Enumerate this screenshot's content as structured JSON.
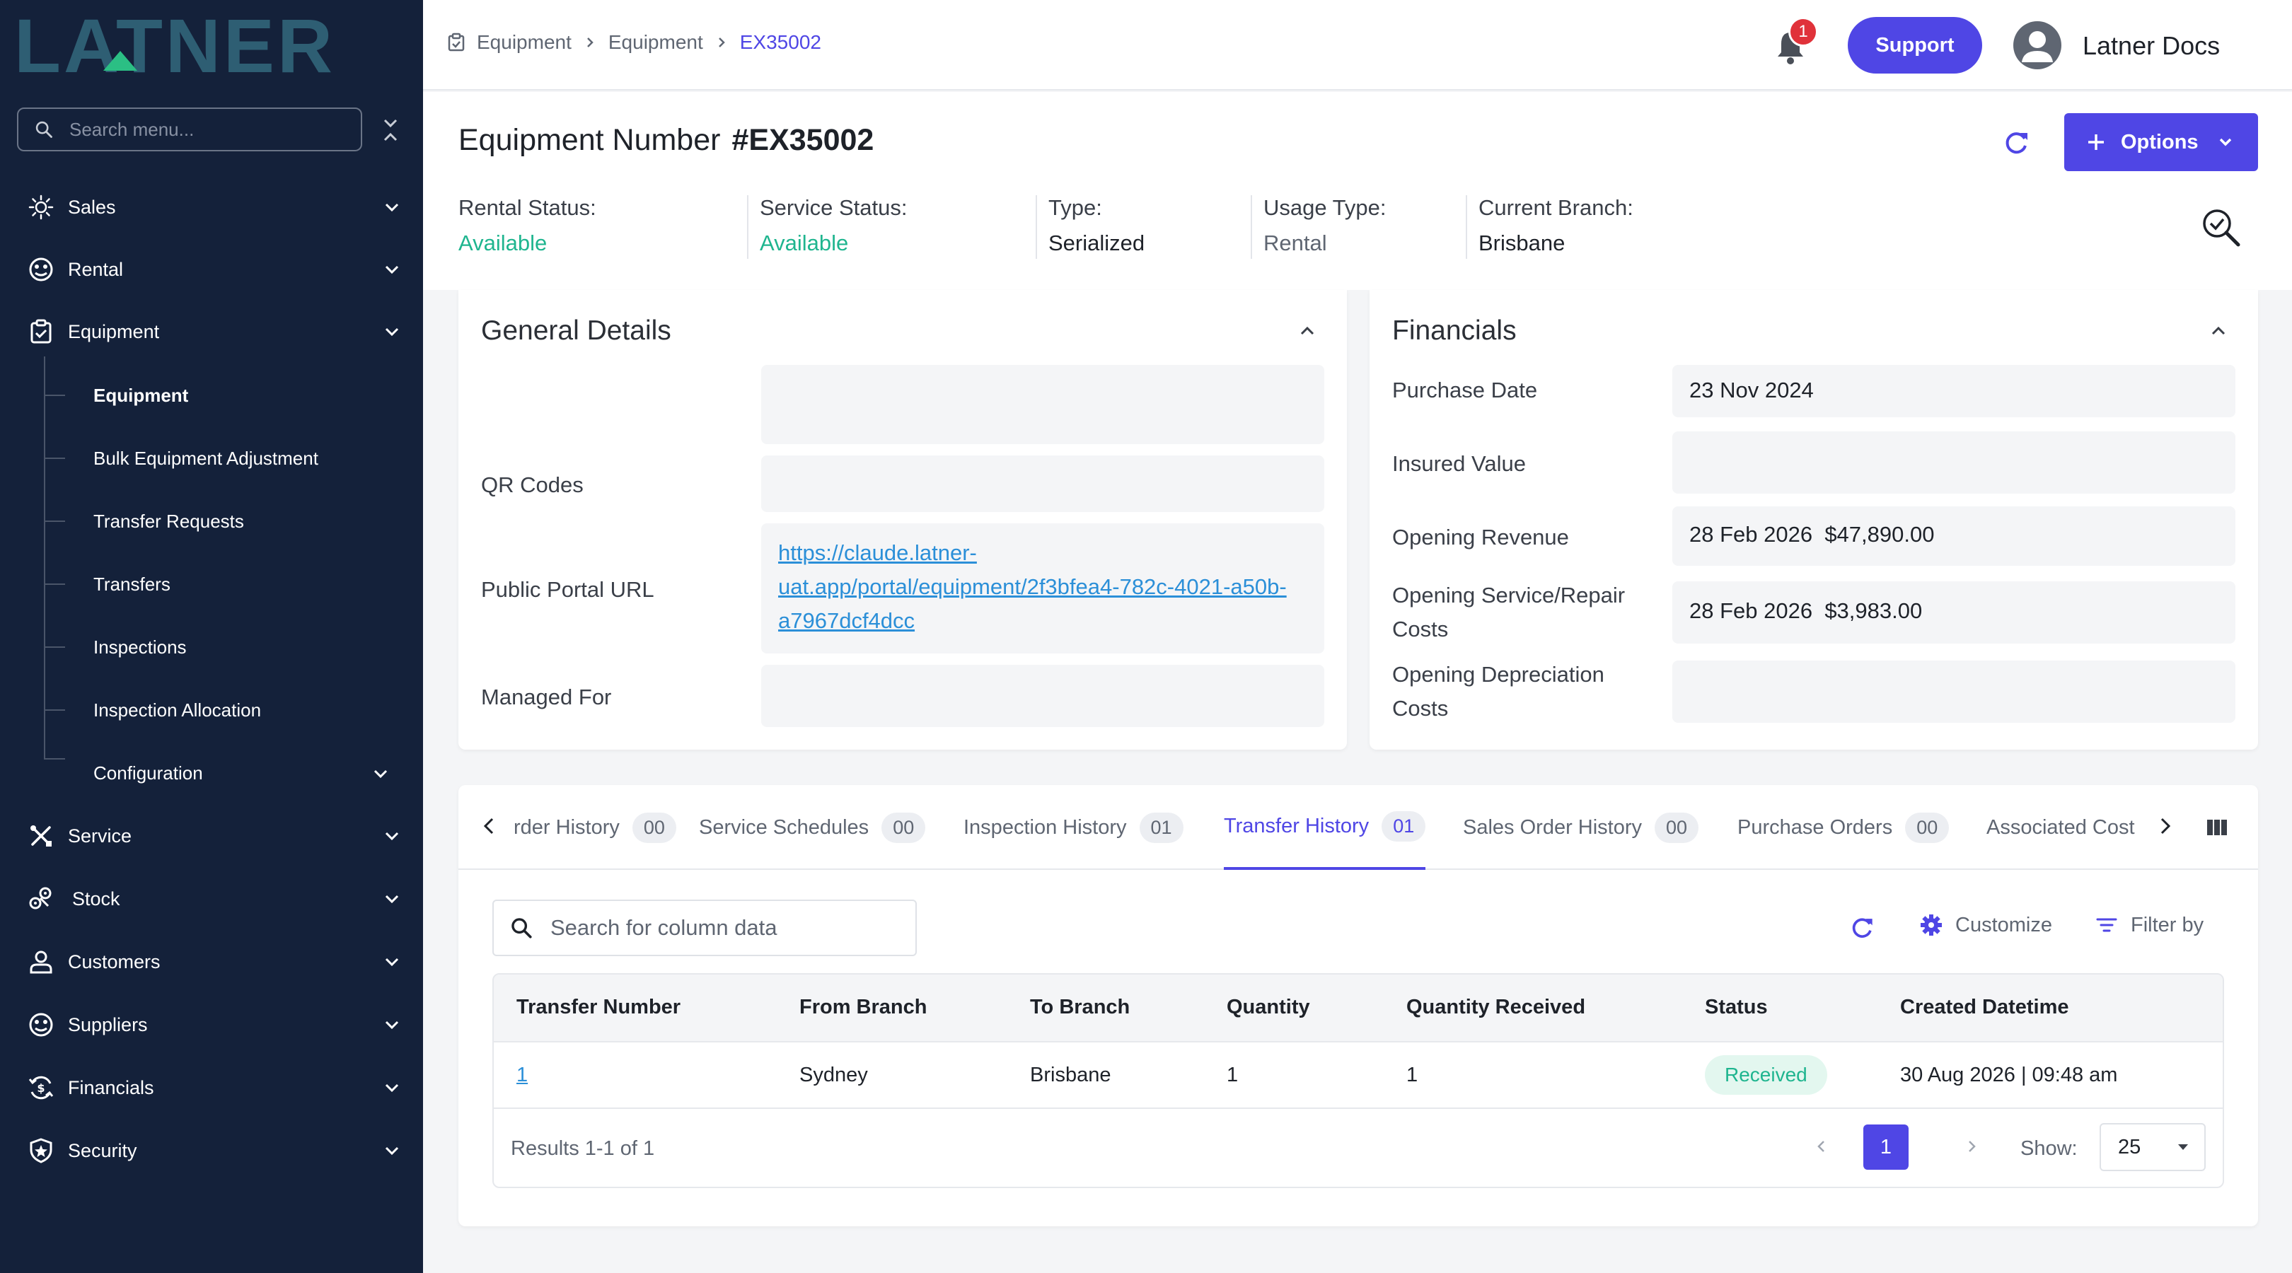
{
  "sidebar": {
    "logo_text": "LATNER",
    "search_placeholder": "Search menu...",
    "items": [
      {
        "label": "Sales",
        "icon": "sales-icon"
      },
      {
        "label": "Rental",
        "icon": "rental-icon"
      },
      {
        "label": "Equipment",
        "icon": "equipment-icon"
      },
      {
        "label": "Service",
        "icon": "service-icon"
      },
      {
        "label": "Stock",
        "icon": "stock-icon"
      },
      {
        "label": "Customers",
        "icon": "customers-icon"
      },
      {
        "label": "Suppliers",
        "icon": "suppliers-icon"
      },
      {
        "label": "Financials",
        "icon": "financials-icon"
      },
      {
        "label": "Security",
        "icon": "security-icon"
      }
    ],
    "equipment_sub": [
      {
        "label": "Equipment",
        "active": true
      },
      {
        "label": "Bulk Equipment Adjustment"
      },
      {
        "label": "Transfer Requests"
      },
      {
        "label": "Transfers"
      },
      {
        "label": "Inspections"
      },
      {
        "label": "Inspection Allocation"
      },
      {
        "label": "Configuration"
      }
    ]
  },
  "topbar": {
    "breadcrumbs": [
      "Equipment",
      "Equipment",
      "EX35002"
    ],
    "notification_count": "1",
    "support_label": "Support",
    "user_name": "Latner Docs"
  },
  "header": {
    "title_label": "Equipment Number",
    "title_value": "#EX35002",
    "options_label": "Options",
    "stats": [
      {
        "label": "Rental Status:",
        "value": "Available"
      },
      {
        "label": "Service Status:",
        "value": "Available"
      },
      {
        "label": "Type:",
        "value": "Serialized"
      },
      {
        "label": "Usage Type:",
        "value": "Rental"
      },
      {
        "label": "Current Branch:",
        "value": "Brisbane"
      }
    ]
  },
  "general_details": {
    "title": "General Details",
    "qr_label": "QR Codes",
    "portal_label": "Public Portal URL",
    "portal_url": "https://claude.latner-uat.app/portal/equipment/2f3bfea4-782c-4021-a50b-a7967dcf4dcc",
    "managed_label": "Managed For"
  },
  "financials": {
    "title": "Financials",
    "rows": [
      {
        "label": "Purchase Date",
        "value": "23 Nov 2024"
      },
      {
        "label": "Insured Value",
        "value": ""
      },
      {
        "label": "Opening Revenue",
        "value": "28 Feb 2026  $47,890.00"
      },
      {
        "label": "Opening Service/Repair Costs",
        "value": "28 Feb 2026  $3,983.00"
      },
      {
        "label": "Opening Depreciation Costs",
        "value": ""
      }
    ]
  },
  "tabs": [
    {
      "label": "rder History",
      "count": "00"
    },
    {
      "label": "Service Schedules",
      "count": "00"
    },
    {
      "label": "Inspection History",
      "count": "01"
    },
    {
      "label": "Transfer History",
      "count": "01",
      "active": true
    },
    {
      "label": "Sales Order History",
      "count": "00"
    },
    {
      "label": "Purchase Orders",
      "count": "00"
    },
    {
      "label": "Associated Costs",
      "count": ""
    }
  ],
  "table": {
    "search_placeholder": "Search for column data",
    "customize_label": "Customize",
    "filter_label": "Filter by",
    "columns": [
      "Transfer Number",
      "From Branch",
      "To Branch",
      "Quantity",
      "Quantity Received",
      "Status",
      "Created Datetime"
    ],
    "rows": [
      {
        "transfer_number": "1",
        "from_branch": "Sydney",
        "to_branch": "Brisbane",
        "quantity": "1",
        "quantity_received": "1",
        "status": "Received",
        "created": "30 Aug 2026 | 09:48 am"
      }
    ],
    "results_text": "Results 1-1 of 1",
    "current_page": "1",
    "show_label": "Show:",
    "page_size": "25"
  },
  "colors": {
    "sidebar_bg": "#14213a",
    "accent": "#4f46e5",
    "success": "#1fb58f",
    "link": "#2b8fd8",
    "logo_teal": "#2e5e73",
    "logo_green": "#2bbf84"
  }
}
